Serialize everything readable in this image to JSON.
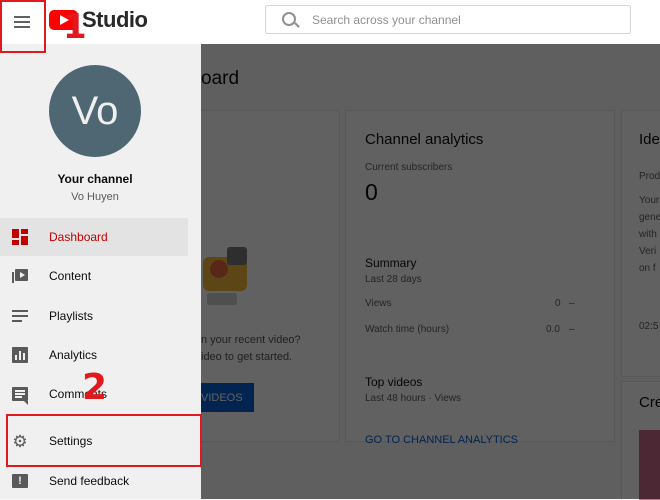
{
  "header": {
    "logo_text": "Studio",
    "search_placeholder": "Search across your channel"
  },
  "sidebar": {
    "avatar_initials": "Vo",
    "channel_title": "Your channel",
    "channel_user": "Vo Huyen",
    "items": [
      {
        "label": "Dashboard",
        "icon": "dashboard-icon",
        "active": true
      },
      {
        "label": "Content",
        "icon": "content-icon"
      },
      {
        "label": "Playlists",
        "icon": "playlists-icon"
      },
      {
        "label": "Analytics",
        "icon": "analytics-icon"
      },
      {
        "label": "Comments",
        "icon": "comments-icon"
      },
      {
        "label": "Settings",
        "icon": "gear-icon"
      },
      {
        "label": "Send feedback",
        "icon": "feedback-icon"
      }
    ]
  },
  "main": {
    "title_fragment": "oard",
    "upload_card": {
      "line1": "n your recent video?",
      "line2": "ideo to get started.",
      "button_label": "VIDEOS"
    },
    "analytics": {
      "title": "Channel analytics",
      "subs_label": "Current subscribers",
      "subs_value": "0",
      "summary_title": "Summary",
      "summary_period": "Last 28 days",
      "rows": [
        {
          "label": "Views",
          "value": "0",
          "change": "–"
        },
        {
          "label": "Watch time (hours)",
          "value": "0.0",
          "change": "–"
        }
      ],
      "top_videos_title": "Top videos",
      "top_videos_period": "Last 48 hours · Views",
      "link_label": "GO TO CHANNEL ANALYTICS"
    },
    "ideas": {
      "title": "Ide",
      "lines": [
        "Prod",
        "Your",
        "gene",
        "with",
        "Veri",
        "on f"
      ],
      "footer": "02:5",
      "create_title": "Cre"
    }
  },
  "annotations": {
    "step1": "1",
    "step2": "2"
  },
  "colors": {
    "brand_red": "#ff0000",
    "active_red": "#cc0000",
    "highlight": "#e0191f",
    "link_blue": "#065fd4"
  }
}
